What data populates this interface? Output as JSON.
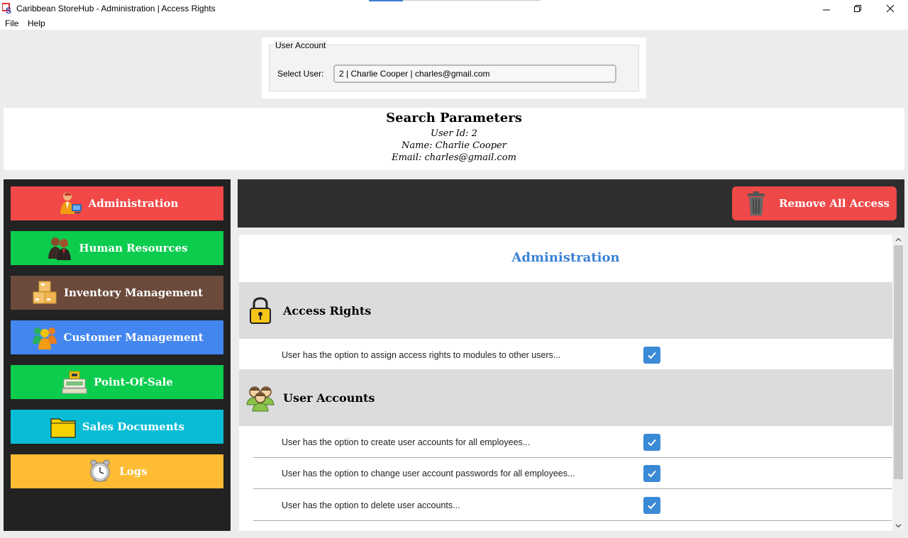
{
  "window": {
    "title": "Caribbean StoreHub - Administration | Access Rights"
  },
  "menu": {
    "file": "File",
    "help": "Help"
  },
  "user_account": {
    "legend": "User Account",
    "select_label": "Select User:",
    "selected_value": "2 | Charlie Cooper | charles@gmail.com"
  },
  "search": {
    "title": "Search Parameters",
    "user_id": "User Id: 2",
    "name": "Name: Charlie Cooper",
    "email": "Email: charles@gmail.com"
  },
  "sidebar": {
    "items": [
      {
        "label": "Administration",
        "icon": "administrator-icon",
        "color": "#f24848"
      },
      {
        "label": "Human Resources",
        "icon": "people-icon",
        "color": "#0ccc4e"
      },
      {
        "label": "Inventory Management",
        "icon": "boxes-icon",
        "color": "#6b4a3c"
      },
      {
        "label": "Customer Management",
        "icon": "customers-icon",
        "color": "#4486f0"
      },
      {
        "label": "Point-Of-Sale",
        "icon": "cash-register-icon",
        "color": "#0ccc4e"
      },
      {
        "label": "Sales Documents",
        "icon": "folder-icon",
        "color": "#08bcd6"
      },
      {
        "label": "Logs",
        "icon": "alarm-clock-icon",
        "color": "#fdbc34"
      }
    ]
  },
  "header": {
    "remove_all_label": "Remove All Access",
    "remove_color": "#ef4848"
  },
  "content": {
    "title": "Administration",
    "sections": [
      {
        "label": "Access Rights",
        "icon": "padlock-icon",
        "permissions": [
          {
            "text": "User has the option to assign access rights to modules to other users...",
            "checked": true
          }
        ]
      },
      {
        "label": "User Accounts",
        "icon": "user-group-icon",
        "permissions": [
          {
            "text": "User has the option to create user accounts for all employees...",
            "checked": true
          },
          {
            "text": "User has the option to change user account passwords for all employees...",
            "checked": true
          },
          {
            "text": "User has the option to delete user accounts...",
            "checked": true
          }
        ]
      }
    ]
  }
}
